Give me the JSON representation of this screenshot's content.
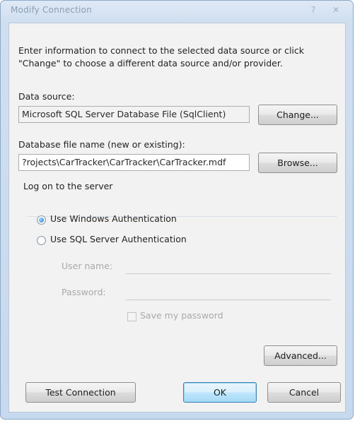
{
  "window": {
    "title": "Modify Connection",
    "help_glyph": "?",
    "close_glyph": "✕"
  },
  "intro": "Enter information to connect to the selected data source or click\n\"Change\" to choose a different data source and/or provider.",
  "data_source": {
    "label": "Data source:",
    "value": "Microsoft SQL Server Database File (SqlClient)",
    "change_button": "Change..."
  },
  "database_file": {
    "label": "Database file name (new or existing):",
    "value": "?rojects\\CarTracker\\CarTracker\\CarTracker.mdf",
    "browse_button": "Browse..."
  },
  "logon": {
    "group_label": "Log on to the server",
    "windows_auth_label": "Use Windows Authentication",
    "windows_auth_checked": true,
    "sql_auth_label": "Use SQL Server Authentication",
    "sql_auth_checked": false,
    "user_name_label": "User name:",
    "user_name_value": "",
    "password_label": "Password:",
    "password_value": "",
    "save_password_label": "Save my password",
    "save_password_checked": false
  },
  "buttons": {
    "advanced": "Advanced...",
    "test_connection": "Test Connection",
    "ok": "OK",
    "cancel": "Cancel"
  },
  "colors": {
    "window_frame": "#c7d9ee",
    "client_background": "#f2f2f2",
    "default_button_border": "#3c7fb1"
  }
}
